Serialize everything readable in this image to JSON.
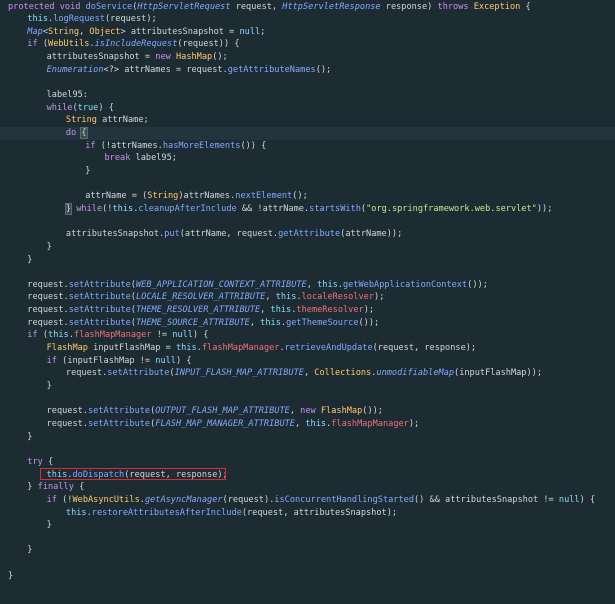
{
  "editor": {
    "highlight_color": "#e2272d",
    "lines": [
      {
        "indent": 0,
        "tokens": [
          [
            "kw",
            "protected "
          ],
          [
            "kw",
            "void "
          ],
          [
            "fn",
            "doService"
          ],
          [
            "plain",
            "("
          ],
          [
            "itype",
            "HttpServletRequest"
          ],
          [
            "plain",
            " request, "
          ],
          [
            "itype",
            "HttpServletResponse"
          ],
          [
            "plain",
            " response) "
          ],
          [
            "kw",
            "throws "
          ],
          [
            "type",
            "Exception"
          ],
          [
            "plain",
            " {"
          ]
        ]
      },
      {
        "indent": 1,
        "tokens": [
          [
            "kw2",
            "this"
          ],
          [
            "plain",
            "."
          ],
          [
            "fn",
            "logRequest"
          ],
          [
            "plain",
            "(request);"
          ]
        ]
      },
      {
        "indent": 1,
        "tokens": [
          [
            "itype",
            "Map"
          ],
          [
            "plain",
            "<"
          ],
          [
            "type",
            "String"
          ],
          [
            "plain",
            ", "
          ],
          [
            "type",
            "Object"
          ],
          [
            "plain",
            "> attributesSnapshot = "
          ],
          [
            "kw2",
            "null"
          ],
          [
            "plain",
            ";"
          ]
        ]
      },
      {
        "indent": 1,
        "tokens": [
          [
            "kw",
            "if "
          ],
          [
            "plain",
            "("
          ],
          [
            "type",
            "WebUtils"
          ],
          [
            "plain",
            "."
          ],
          [
            "italic-fn",
            "isIncludeRequest"
          ],
          [
            "plain",
            "(request)) {"
          ]
        ]
      },
      {
        "indent": 2,
        "tokens": [
          [
            "var",
            "attributesSnapshot"
          ],
          [
            "plain",
            " = "
          ],
          [
            "kw",
            "new "
          ],
          [
            "type",
            "HashMap"
          ],
          [
            "plain",
            "();"
          ]
        ]
      },
      {
        "indent": 2,
        "tokens": [
          [
            "itype",
            "Enumeration"
          ],
          [
            "plain",
            "<?> "
          ],
          [
            "var",
            "attrNames"
          ],
          [
            "plain",
            " = request."
          ],
          [
            "fn",
            "getAttributeNames"
          ],
          [
            "plain",
            "();"
          ]
        ]
      },
      {
        "indent": 0,
        "tokens": []
      },
      {
        "indent": 2,
        "tokens": [
          [
            "label",
            "label95:"
          ]
        ]
      },
      {
        "indent": 2,
        "tokens": [
          [
            "kw",
            "while"
          ],
          [
            "plain",
            "("
          ],
          [
            "kw2",
            "true"
          ],
          [
            "plain",
            ") {"
          ]
        ]
      },
      {
        "indent": 3,
        "tokens": [
          [
            "type",
            "String "
          ],
          [
            "var",
            "attrName"
          ],
          [
            "plain",
            ";"
          ]
        ]
      },
      {
        "indent": 3,
        "current": true,
        "tokens": [
          [
            "kw",
            "do "
          ],
          [
            "brace",
            "{"
          ]
        ]
      },
      {
        "indent": 4,
        "tokens": [
          [
            "kw",
            "if "
          ],
          [
            "plain",
            "(!"
          ],
          [
            "var",
            "attrNames"
          ],
          [
            "plain",
            "."
          ],
          [
            "fn",
            "hasMoreElements"
          ],
          [
            "plain",
            "()) {"
          ]
        ]
      },
      {
        "indent": 5,
        "tokens": [
          [
            "kw",
            "break "
          ],
          [
            "plain",
            "label95;"
          ]
        ]
      },
      {
        "indent": 4,
        "tokens": [
          [
            "plain",
            "}"
          ]
        ]
      },
      {
        "indent": 0,
        "tokens": []
      },
      {
        "indent": 4,
        "tokens": [
          [
            "var",
            "attrName"
          ],
          [
            "plain",
            " = ("
          ],
          [
            "type",
            "String"
          ],
          [
            "plain",
            ")"
          ],
          [
            "var",
            "attrNames"
          ],
          [
            "plain",
            "."
          ],
          [
            "fn",
            "nextElement"
          ],
          [
            "plain",
            "();"
          ]
        ]
      },
      {
        "indent": 3,
        "tokens": [
          [
            "brace",
            "}"
          ],
          [
            "kw",
            " while"
          ],
          [
            "plain",
            "(!"
          ],
          [
            "kw2",
            "this"
          ],
          [
            "plain",
            "."
          ],
          [
            "fn",
            "cleanupAfterInclude"
          ],
          [
            "plain",
            " && !"
          ],
          [
            "var",
            "attrName"
          ],
          [
            "plain",
            "."
          ],
          [
            "fn",
            "startsWith"
          ],
          [
            "plain",
            "("
          ],
          [
            "str",
            "\"org.springframework.web.servlet\""
          ],
          [
            "plain",
            "));"
          ]
        ]
      },
      {
        "indent": 0,
        "tokens": []
      },
      {
        "indent": 3,
        "tokens": [
          [
            "var",
            "attributesSnapshot"
          ],
          [
            "plain",
            "."
          ],
          [
            "fn",
            "put"
          ],
          [
            "plain",
            "(attrName, request."
          ],
          [
            "fn",
            "getAttribute"
          ],
          [
            "plain",
            "(attrName));"
          ]
        ]
      },
      {
        "indent": 2,
        "tokens": [
          [
            "plain",
            "}"
          ]
        ]
      },
      {
        "indent": 1,
        "tokens": [
          [
            "plain",
            "}"
          ]
        ]
      },
      {
        "indent": 0,
        "tokens": []
      },
      {
        "indent": 1,
        "tokens": [
          [
            "plain",
            "request."
          ],
          [
            "fn",
            "setAttribute"
          ],
          [
            "plain",
            "("
          ],
          [
            "const",
            "WEB_APPLICATION_CONTEXT_ATTRIBUTE"
          ],
          [
            "plain",
            ", "
          ],
          [
            "kw2",
            "this"
          ],
          [
            "plain",
            "."
          ],
          [
            "fn",
            "getWebApplicationContext"
          ],
          [
            "plain",
            "());"
          ]
        ]
      },
      {
        "indent": 1,
        "tokens": [
          [
            "plain",
            "request."
          ],
          [
            "fn",
            "setAttribute"
          ],
          [
            "plain",
            "("
          ],
          [
            "const",
            "LOCALE_RESOLVER_ATTRIBUTE"
          ],
          [
            "plain",
            ", "
          ],
          [
            "kw2",
            "this"
          ],
          [
            "plain",
            "."
          ],
          [
            "field",
            "localeResolver"
          ],
          [
            "plain",
            ");"
          ]
        ]
      },
      {
        "indent": 1,
        "tokens": [
          [
            "plain",
            "request."
          ],
          [
            "fn",
            "setAttribute"
          ],
          [
            "plain",
            "("
          ],
          [
            "const",
            "THEME_RESOLVER_ATTRIBUTE"
          ],
          [
            "plain",
            ", "
          ],
          [
            "kw2",
            "this"
          ],
          [
            "plain",
            "."
          ],
          [
            "field",
            "themeResolver"
          ],
          [
            "plain",
            ");"
          ]
        ]
      },
      {
        "indent": 1,
        "tokens": [
          [
            "plain",
            "request."
          ],
          [
            "fn",
            "setAttribute"
          ],
          [
            "plain",
            "("
          ],
          [
            "const",
            "THEME_SOURCE_ATTRIBUTE"
          ],
          [
            "plain",
            ", "
          ],
          [
            "kw2",
            "this"
          ],
          [
            "plain",
            "."
          ],
          [
            "fn",
            "getThemeSource"
          ],
          [
            "plain",
            "());"
          ]
        ]
      },
      {
        "indent": 1,
        "tokens": [
          [
            "kw",
            "if "
          ],
          [
            "plain",
            "("
          ],
          [
            "kw2",
            "this"
          ],
          [
            "plain",
            "."
          ],
          [
            "field",
            "flashMapManager"
          ],
          [
            "plain",
            " != "
          ],
          [
            "kw2",
            "null"
          ],
          [
            "plain",
            ") {"
          ]
        ]
      },
      {
        "indent": 2,
        "tokens": [
          [
            "type",
            "FlashMap "
          ],
          [
            "var",
            "inputFlashMap"
          ],
          [
            "plain",
            " = "
          ],
          [
            "kw2",
            "this"
          ],
          [
            "plain",
            "."
          ],
          [
            "field",
            "flashMapManager"
          ],
          [
            "plain",
            "."
          ],
          [
            "fn",
            "retrieveAndUpdate"
          ],
          [
            "plain",
            "(request, response);"
          ]
        ]
      },
      {
        "indent": 2,
        "tokens": [
          [
            "kw",
            "if "
          ],
          [
            "plain",
            "("
          ],
          [
            "var",
            "inputFlashMap"
          ],
          [
            "plain",
            " != "
          ],
          [
            "kw2",
            "null"
          ],
          [
            "plain",
            ") {"
          ]
        ]
      },
      {
        "indent": 3,
        "tokens": [
          [
            "plain",
            "request."
          ],
          [
            "fn",
            "setAttribute"
          ],
          [
            "plain",
            "("
          ],
          [
            "const",
            "INPUT_FLASH_MAP_ATTRIBUTE"
          ],
          [
            "plain",
            ", "
          ],
          [
            "type",
            "Collections"
          ],
          [
            "plain",
            "."
          ],
          [
            "italic-fn",
            "unmodifiableMap"
          ],
          [
            "plain",
            "("
          ],
          [
            "var",
            "inputFlashMap"
          ],
          [
            "plain",
            "));"
          ]
        ]
      },
      {
        "indent": 2,
        "tokens": [
          [
            "plain",
            "}"
          ]
        ]
      },
      {
        "indent": 0,
        "tokens": []
      },
      {
        "indent": 2,
        "tokens": [
          [
            "plain",
            "request."
          ],
          [
            "fn",
            "setAttribute"
          ],
          [
            "plain",
            "("
          ],
          [
            "const",
            "OUTPUT_FLASH_MAP_ATTRIBUTE"
          ],
          [
            "plain",
            ", "
          ],
          [
            "kw",
            "new "
          ],
          [
            "type",
            "FlashMap"
          ],
          [
            "plain",
            "());"
          ]
        ]
      },
      {
        "indent": 2,
        "tokens": [
          [
            "plain",
            "request."
          ],
          [
            "fn",
            "setAttribute"
          ],
          [
            "plain",
            "("
          ],
          [
            "const",
            "FLASH_MAP_MANAGER_ATTRIBUTE"
          ],
          [
            "plain",
            ", "
          ],
          [
            "kw2",
            "this"
          ],
          [
            "plain",
            "."
          ],
          [
            "field",
            "flashMapManager"
          ],
          [
            "plain",
            ");"
          ]
        ]
      },
      {
        "indent": 1,
        "tokens": [
          [
            "plain",
            "}"
          ]
        ]
      },
      {
        "indent": 0,
        "tokens": []
      },
      {
        "indent": 1,
        "tokens": [
          [
            "kw",
            "try "
          ],
          [
            "plain",
            "{"
          ]
        ]
      },
      {
        "indent": 2,
        "boxed": true,
        "tokens": [
          [
            "kw2",
            "this"
          ],
          [
            "plain",
            "."
          ],
          [
            "fn",
            "doDispatch"
          ],
          [
            "plain",
            "(request, response);"
          ]
        ]
      },
      {
        "indent": 1,
        "tokens": [
          [
            "plain",
            "} "
          ],
          [
            "kw",
            "finally "
          ],
          [
            "plain",
            "{"
          ]
        ]
      },
      {
        "indent": 2,
        "tokens": [
          [
            "kw",
            "if "
          ],
          [
            "plain",
            "(!"
          ],
          [
            "type",
            "WebAsyncUtils"
          ],
          [
            "plain",
            "."
          ],
          [
            "italic-fn",
            "getAsyncManager"
          ],
          [
            "plain",
            "(request)."
          ],
          [
            "fn",
            "isConcurrentHandlingStarted"
          ],
          [
            "plain",
            "() && "
          ],
          [
            "var",
            "attributesSnapshot"
          ],
          [
            "plain",
            " != "
          ],
          [
            "kw2",
            "null"
          ],
          [
            "plain",
            ") {"
          ]
        ]
      },
      {
        "indent": 3,
        "tokens": [
          [
            "kw2",
            "this"
          ],
          [
            "plain",
            "."
          ],
          [
            "fn",
            "restoreAttributesAfterInclude"
          ],
          [
            "plain",
            "(request, "
          ],
          [
            "var",
            "attributesSnapshot"
          ],
          [
            "plain",
            ");"
          ]
        ]
      },
      {
        "indent": 2,
        "tokens": [
          [
            "plain",
            "}"
          ]
        ]
      },
      {
        "indent": 0,
        "tokens": []
      },
      {
        "indent": 1,
        "tokens": [
          [
            "plain",
            "}"
          ]
        ]
      },
      {
        "indent": 0,
        "tokens": []
      },
      {
        "indent": 0,
        "tokens": [
          [
            "plain",
            "}"
          ]
        ]
      }
    ]
  }
}
